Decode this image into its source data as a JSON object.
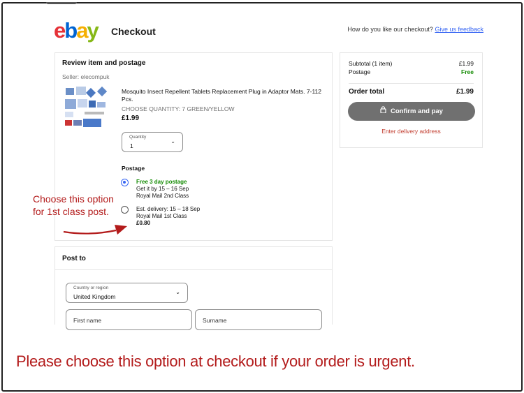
{
  "header": {
    "logo_text": [
      "e",
      "b",
      "a",
      "y"
    ],
    "title": "Checkout",
    "feedback_prompt": "How do you like our checkout?",
    "feedback_link": "Give us feedback"
  },
  "review": {
    "heading": "Review item and postage",
    "seller": "Seller:  elecompuk",
    "item_title": "Mosquito Insect Repellent Tablets Replacement Plug in Adaptor Mats. 7-112 Pcs.",
    "item_variant": "Choose Quantity: 7 Green/Yellow",
    "item_price": "£1.99",
    "quantity_label": "Quantity",
    "quantity_value": "1",
    "postage_heading": "Postage",
    "options": [
      {
        "title": "Free 3 day postage",
        "line2": "Get it by 15 – 16 Sep",
        "line3": "Royal Mail 2nd Class",
        "selected": true
      },
      {
        "title": "Est. delivery: 15 – 18 Sep",
        "line2": "Royal Mail 1st Class",
        "line3": "£0.80",
        "selected": false
      }
    ]
  },
  "annotation": {
    "line1": "Choose this option",
    "line2": "for 1st class post.",
    "color": "#b31b1b"
  },
  "post_to": {
    "heading": "Post to",
    "country_label": "Country or region",
    "country_value": "United Kingdom",
    "first_name_placeholder": "First name",
    "surname_placeholder": "Surname"
  },
  "summary": {
    "subtotal_label": "Subtotal (1 item)",
    "subtotal_value": "£1.99",
    "postage_label": "Postage",
    "postage_value": "Free",
    "total_label": "Order total",
    "total_value": "£1.99",
    "confirm_button": "Confirm and pay",
    "enter_address": "Enter delivery address"
  },
  "bottom_note": "Please choose this option at checkout if your order is urgent.",
  "colors": {
    "accent": "#3665f3",
    "free_green": "#118a00",
    "annotation_red": "#b31b1b",
    "button_gray": "#707070"
  }
}
